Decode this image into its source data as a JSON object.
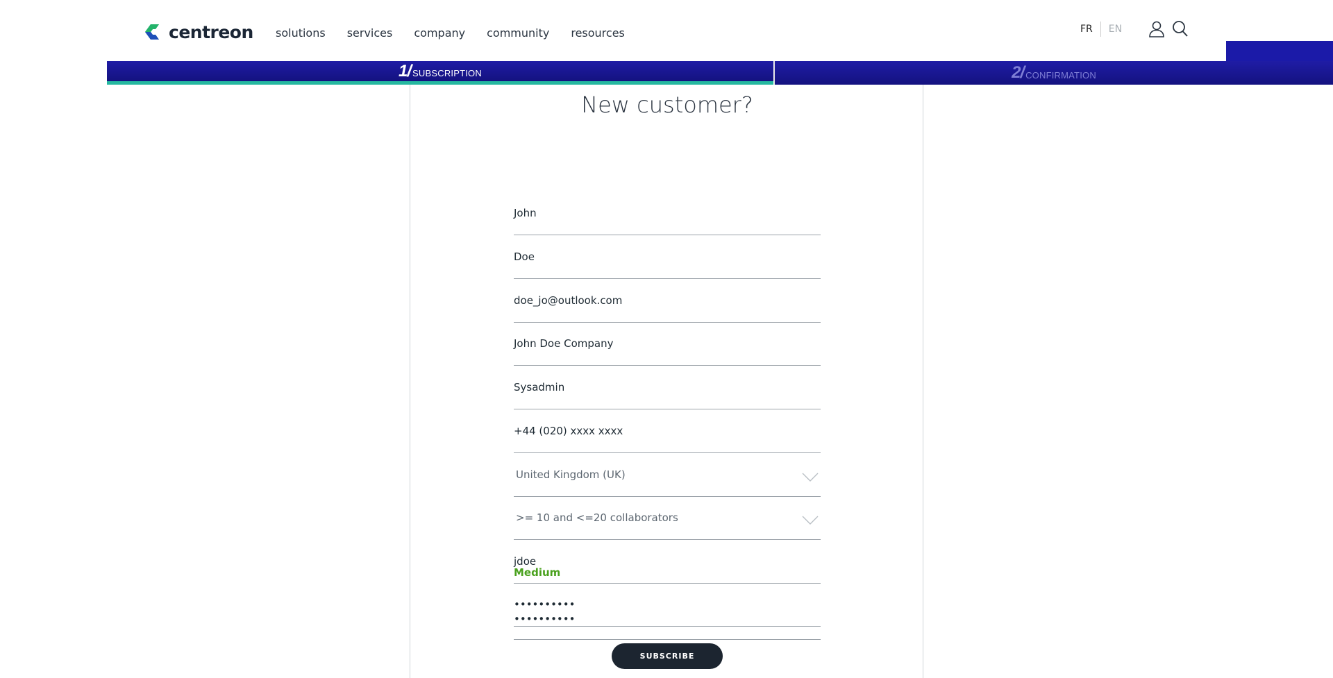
{
  "header": {
    "brand": "centreon",
    "nav": [
      "solutions",
      "services",
      "company",
      "community",
      "resources"
    ],
    "lang_active": "FR",
    "lang_inactive": "EN"
  },
  "steps": [
    {
      "num": "1/",
      "label": "SUBSCRIPTION",
      "active": true
    },
    {
      "num": "2/",
      "label": "CONFIRMATION",
      "active": false
    }
  ],
  "form": {
    "title": "New customer?",
    "first_name": "John",
    "last_name": "Doe",
    "email": "doe_jo@outlook.com",
    "company": "John Doe Company",
    "job": "Sysadmin",
    "phone": "+44 (020) xxxx xxxx",
    "country": "United Kingdom (UK)",
    "company_size": ">= 10 and <=20 collaborators",
    "username": "jdoe",
    "password": "••••••••••",
    "password_strength": "Medium",
    "password_confirm": "••••••••••",
    "subscribe_label": "SUBSCRIBE"
  },
  "colors": {
    "primary": "#1b1aa8",
    "accent": "#25b8a0",
    "strength": "#4aa11e",
    "button": "#1c2530"
  }
}
